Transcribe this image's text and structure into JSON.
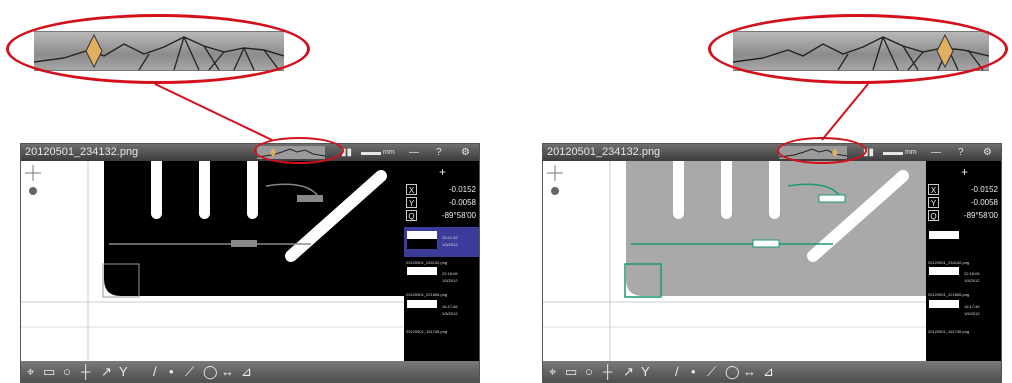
{
  "screens": {
    "left": {
      "title": "20120501_234132.png",
      "titlebar_icons": [
        "film-icon",
        "ruler-icon",
        "label-icon",
        "menu-icon",
        "help-icon",
        "settings-icon"
      ],
      "titlebar_labels": {
        "help": "?",
        "settings": "⚙"
      },
      "readout": {
        "x_label": "X",
        "x": "-0.0152",
        "y_label": "Y",
        "y": "-0.0058",
        "a_label": "Q",
        "a": "-89°58'00"
      },
      "thumbnails": [
        {
          "label": "20120501_234132.png",
          "meta1": "23:41:32",
          "meta2": "1/5/2012"
        },
        {
          "label": "20120501_221806.png",
          "meta1": "22:18:06",
          "meta2": "1/5/2012"
        },
        {
          "label": "20120501_161746.png",
          "meta1": "16:17:46",
          "meta2": "1/5/2012"
        },
        {
          "label": "20120501_161746.png",
          "meta1": "",
          "meta2": ""
        }
      ],
      "accent": "#3b3b9a"
    },
    "right": {
      "title": "20120501_234132.png",
      "titlebar_icons": [
        "film-icon",
        "ruler-icon",
        "label-icon",
        "menu-icon",
        "help-icon",
        "settings-icon"
      ],
      "titlebar_labels": {
        "help": "?",
        "settings": "⚙"
      },
      "readout": {
        "x_label": "X",
        "x": "-0.0152",
        "y_label": "Y",
        "y": "-0.0058",
        "a_label": "Q",
        "a": "-89°58'00"
      },
      "thumbnails": [
        {
          "label": "20120501_234132.png",
          "meta1": "",
          "meta2": ""
        },
        {
          "label": "20120501_221806.png",
          "meta1": "22:18:06",
          "meta2": "1/5/2012"
        },
        {
          "label": "20120501_161746.png",
          "meta1": "16:17:46",
          "meta2": "1/5/2012"
        },
        {
          "label": "20120501_161746.png",
          "meta1": "",
          "meta2": ""
        }
      ],
      "accent": "#1c9a6a"
    }
  },
  "colors": {
    "callout": "#d4101b",
    "marker": "#e0b060",
    "measure_left": "#999999",
    "measure_right": "#1c9a6a"
  },
  "toolbar_icons": [
    "crosshair-icon",
    "rectangle-icon",
    "circle-icon",
    "point-icon",
    "line-icon",
    "angle-icon",
    "distance-icon",
    "arc-icon",
    "polygon-icon"
  ]
}
